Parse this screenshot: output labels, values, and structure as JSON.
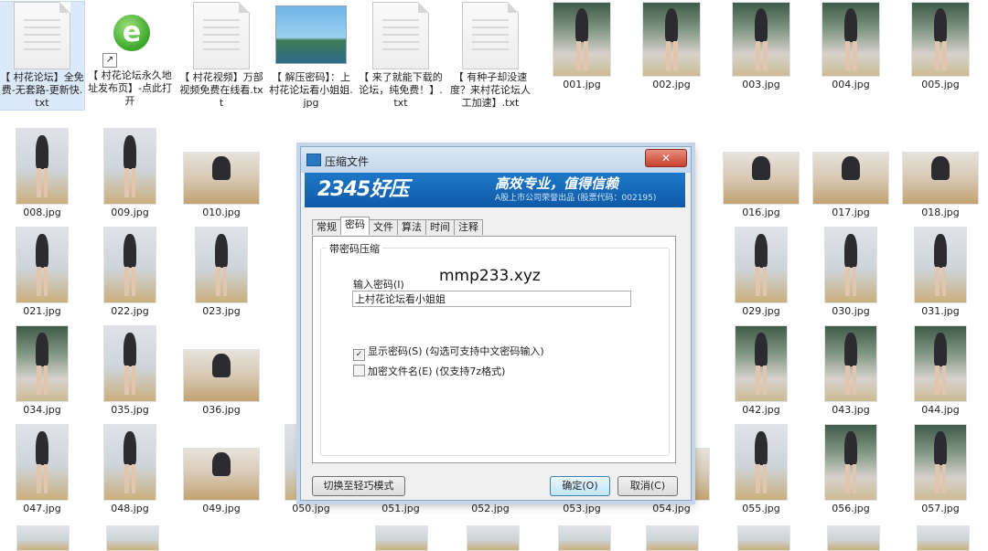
{
  "desktop_files": {
    "doc1": "【 村花论坛】全免费-无套路-更新快.txt",
    "ie_link": "【 村花论坛永久地址发布页】-点此打开",
    "doc3": "【 村花视频】万部视频免费在线看.txt",
    "pic_doc": "【 解压密码】：上村花论坛看小姐姐.jpg",
    "doc5": "【 来了就能下载的论坛，纯免费！】.txt",
    "doc6": "【 有种子却没速度？来村花论坛人工加速】.txt",
    "f001": "001.jpg",
    "f002": "002.jpg",
    "f003": "003.jpg",
    "f004": "004.jpg",
    "f005": "005.jpg",
    "f008": "008.jpg",
    "f009": "009.jpg",
    "f010": "010.jpg",
    "f016": "016.jpg",
    "f017": "017.jpg",
    "f018": "018.jpg",
    "f021": "021.jpg",
    "f022": "022.jpg",
    "f023": "023.jpg",
    "f029": "029.jpg",
    "f030": "030.jpg",
    "f031": "031.jpg",
    "f034": "034.jpg",
    "f035": "035.jpg",
    "f036": "036.jpg",
    "f042": "042.jpg",
    "f043": "043.jpg",
    "f044": "044.jpg",
    "f047": "047.jpg",
    "f048": "048.jpg",
    "f049": "049.jpg",
    "f050": "050.jpg",
    "f051": "051.jpg",
    "f052": "052.jpg",
    "f053": "053.jpg",
    "f054": "054.jpg",
    "f055": "055.jpg",
    "f056": "056.jpg",
    "f057": "057.jpg"
  },
  "dialog": {
    "title": "压缩文件",
    "close_glyph": "✕",
    "brand": "2345好压",
    "slogan": "高效专业，值得信赖",
    "corp": "A股上市公司荣誉出品 (股票代码：002195)",
    "tabs": [
      "常规",
      "密码",
      "文件",
      "算法",
      "时间",
      "注释"
    ],
    "active_tab": "密码",
    "group_title": "带密码压缩",
    "password_label": "输入密码(I)",
    "password_value": "上村花论坛看小姐姐",
    "show_password_label": "显示密码(S)  (勾选可支持中文密码输入)",
    "show_password_checked": "✓",
    "encrypt_names_label": "加密文件名(E)  (仅支持7z格式)",
    "switch_mode_button": "切换至轻巧模式",
    "ok_button": "确定(O)",
    "cancel_button": "取消(C)"
  },
  "overlay_text": "mmp233.xyz"
}
